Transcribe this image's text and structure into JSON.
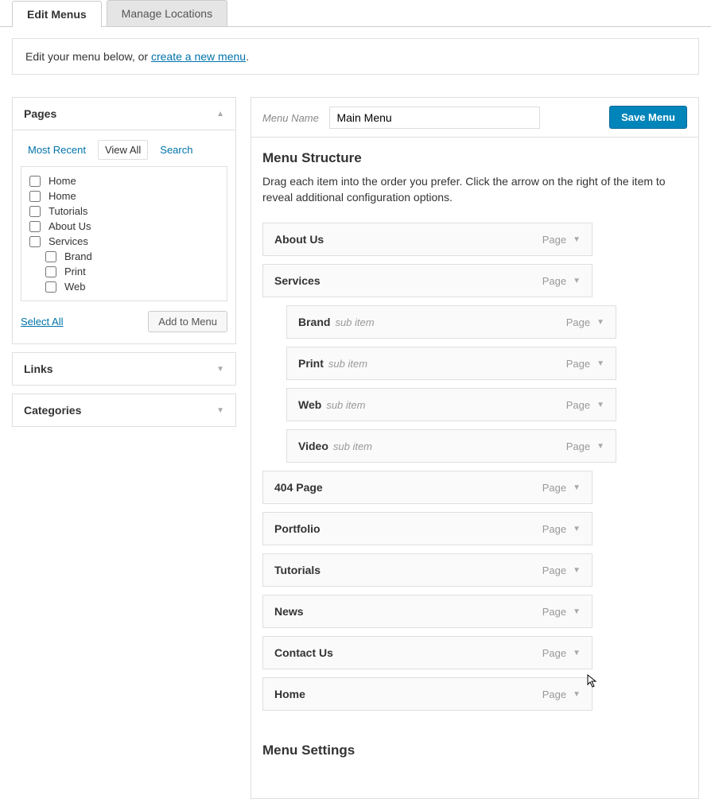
{
  "tabs": {
    "edit": "Edit Menus",
    "manage": "Manage Locations"
  },
  "notice": {
    "prefix": "Edit your menu below, or ",
    "link": "create a new menu",
    "suffix": "."
  },
  "sidebar": {
    "pages": {
      "title": "Pages",
      "subtabs": {
        "recent": "Most Recent",
        "viewall": "View All",
        "search": "Search"
      },
      "items": [
        {
          "label": "Home",
          "indent": false
        },
        {
          "label": "Home",
          "indent": false
        },
        {
          "label": "Tutorials",
          "indent": false
        },
        {
          "label": "About Us",
          "indent": false
        },
        {
          "label": "Services",
          "indent": false
        },
        {
          "label": "Brand",
          "indent": true
        },
        {
          "label": "Print",
          "indent": true
        },
        {
          "label": "Web",
          "indent": true
        }
      ],
      "select_all": "Select All",
      "add_to_menu": "Add to Menu"
    },
    "links": {
      "title": "Links"
    },
    "categories": {
      "title": "Categories"
    }
  },
  "main": {
    "menu_name_label": "Menu Name",
    "menu_name_value": "Main Menu",
    "save_button": "Save Menu",
    "structure_title": "Menu Structure",
    "structure_desc": "Drag each item into the order you prefer. Click the arrow on the right of the item to reveal additional configuration options.",
    "type_label": "Page",
    "sub_item_label": "sub item",
    "items": [
      {
        "label": "About Us",
        "sub": false
      },
      {
        "label": "Services",
        "sub": false
      },
      {
        "label": "Brand",
        "sub": true
      },
      {
        "label": "Print",
        "sub": true
      },
      {
        "label": "Web",
        "sub": true
      },
      {
        "label": "Video",
        "sub": true
      },
      {
        "label": "404 Page",
        "sub": false
      },
      {
        "label": "Portfolio",
        "sub": false
      },
      {
        "label": "Tutorials",
        "sub": false
      },
      {
        "label": "News",
        "sub": false
      },
      {
        "label": "Contact Us",
        "sub": false
      },
      {
        "label": "Home",
        "sub": false
      }
    ],
    "settings_title": "Menu Settings"
  }
}
